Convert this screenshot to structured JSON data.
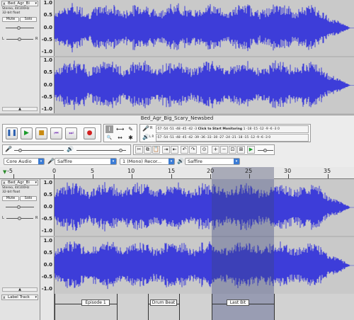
{
  "window": {
    "title": "Bed_Agr_Big_Scary_Newsbed"
  },
  "colors": {
    "waveform": "#3d3dd9",
    "wave_bg": "#c9c9c9",
    "selection": "#5a5f99",
    "accent": "#3a7bd5"
  },
  "top_project": {
    "track": {
      "name": "Bed_Agr_Bi",
      "info1": "Stereo, 44100Hz",
      "info2": "32-bit float",
      "mute": "Mute",
      "solo": "Solo",
      "left": "L",
      "right": "R",
      "close": "x",
      "menu": "▾",
      "collapse": "▲"
    },
    "scale_upper": [
      "1.0",
      "0.5",
      "0.0",
      "-0.5",
      "-1.0"
    ],
    "scale_lower": [
      "1.0",
      "0.5",
      "0.0",
      "-0.5",
      "-1.0"
    ]
  },
  "toolbar": {
    "pause": "❚❚",
    "play": "▶",
    "stop": "■",
    "skip_start": "⏮",
    "skip_end": "⏭",
    "record": "●",
    "tools": [
      "I",
      "⟷",
      "✎",
      "🔍",
      "↔",
      "✱"
    ],
    "record_meter_label": "R",
    "playback_meter_label": "L R",
    "meter_scale": "-57 -54 -51 -48 -45 -42 -3",
    "meter_hint": "Click to Start Monitoring",
    "meter_scale_2": "1 -18 -15 -12 -9 -6 -3 0",
    "playback_scale": "-57 -54 -51 -48 -45 -42 -39 -36 -33 -30 -27 -24 -21 -18 -15 -12 -9 -6 -3 0"
  },
  "device": {
    "host": "Core Audio",
    "input": "Saffire",
    "channels": "1 (Mono) Recor...",
    "output": "Saffire"
  },
  "ruler": {
    "ticks": [
      "-5",
      "0",
      "5",
      "10",
      "15",
      "20",
      "25",
      "30",
      "35"
    ]
  },
  "bottom_project": {
    "track": {
      "name": "Bed_Agr_Bi",
      "info1": "Stereo, 44100Hz",
      "info2": "32-bit float",
      "mute": "Mute",
      "solo": "Solo",
      "left": "L",
      "right": "R",
      "close": "x",
      "menu": "▾",
      "collapse": "▲"
    },
    "scale_upper": [
      "1.0",
      "0.5",
      "0.0",
      "-0.5",
      "-1.0"
    ],
    "scale_lower": [
      "1.0",
      "0.5",
      "0.0",
      "-0.5",
      "-1.0"
    ],
    "label_track": {
      "name": "Label Track",
      "labels": [
        "Episode 1",
        "Drum Beat",
        "Last Bit"
      ]
    }
  }
}
